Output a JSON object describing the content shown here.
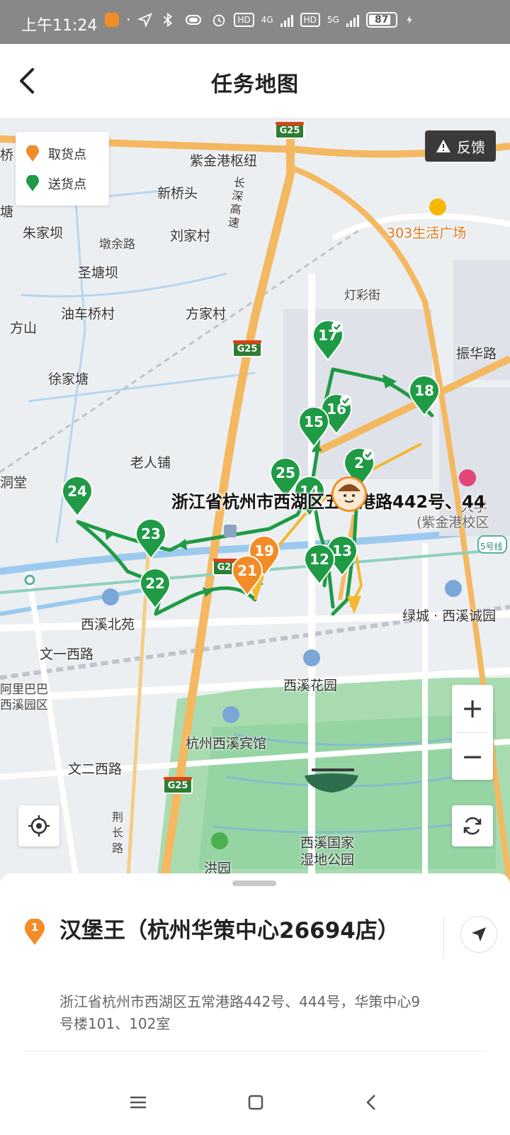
{
  "status_bar": {
    "time": "上午11:24",
    "hd1": "HD",
    "net1": "4G",
    "hd2": "HD",
    "net2": "5G",
    "battery": "87"
  },
  "header": {
    "title": "任务地图"
  },
  "legend": {
    "pickup": "取货点",
    "dropoff": "送货点"
  },
  "feedback": {
    "label": "反馈"
  },
  "map": {
    "rider_address": "浙江省杭州市西湖区五常港路442号、44",
    "places": [
      {
        "text": "紫金港枢纽"
      },
      {
        "text": "新桥头"
      },
      {
        "text": "朱家坝"
      },
      {
        "text": "墩余路"
      },
      {
        "text": "刘家村"
      },
      {
        "text": "圣塘坝"
      },
      {
        "text": "油车桥村"
      },
      {
        "text": "方家村"
      },
      {
        "text": "方山"
      },
      {
        "text": "徐家塘"
      },
      {
        "text": "老人铺"
      },
      {
        "text": "灯彩街"
      },
      {
        "text": "303生活广场"
      },
      {
        "text": "振华路"
      },
      {
        "text": "西溪北苑"
      },
      {
        "text": "文一西路"
      },
      {
        "text": "绿城 · 西溪诚园"
      },
      {
        "text": "西溪花园"
      },
      {
        "text": "杭州西溪宾馆"
      },
      {
        "text": "文二西路"
      },
      {
        "text": "西溪国家"
      },
      {
        "text": "湿地公园"
      },
      {
        "text": "洪园"
      },
      {
        "text": "阿里巴巴"
      },
      {
        "text": "西溪园区"
      },
      {
        "text": "(紫金港校区"
      },
      {
        "text": "长深高速"
      },
      {
        "text": "荆长路"
      },
      {
        "text": "桥"
      },
      {
        "text": "塘"
      },
      {
        "text": "洞堂"
      },
      {
        "text": "大学"
      },
      {
        "text": "5号线"
      }
    ],
    "shields": [
      "G25",
      "G25",
      "G25",
      "G25"
    ],
    "markers": [
      {
        "label": "17",
        "kind": "dropoff",
        "done": true
      },
      {
        "label": "18",
        "kind": "dropoff",
        "done": false
      },
      {
        "label": "16",
        "kind": "dropoff",
        "done": true
      },
      {
        "label": "15",
        "kind": "dropoff",
        "done": false
      },
      {
        "label": "25",
        "kind": "dropoff",
        "done": false
      },
      {
        "label": "14",
        "kind": "dropoff",
        "done": false
      },
      {
        "label": "2",
        "kind": "dropoff",
        "done": true
      },
      {
        "label": "24",
        "kind": "dropoff",
        "done": false
      },
      {
        "label": "23",
        "kind": "dropoff",
        "done": false
      },
      {
        "label": "22",
        "kind": "dropoff",
        "done": false
      },
      {
        "label": "19",
        "kind": "pickup",
        "done": false
      },
      {
        "label": "21",
        "kind": "pickup",
        "done": false
      },
      {
        "label": "13",
        "kind": "dropoff",
        "done": false
      },
      {
        "label": "12",
        "kind": "dropoff",
        "done": false
      }
    ],
    "zoom_in": "+",
    "zoom_out": "−"
  },
  "task": {
    "index": "1",
    "store_name": "汉堡王（杭州华策中心26694店）",
    "address": "浙江省杭州市西湖区五常港路442号、444号，华策中心9号楼101、102室"
  },
  "colors": {
    "pickup": "#f28c28",
    "dropoff": "#1f9a45",
    "route": "#1f9a45",
    "road": "#f4b860"
  }
}
